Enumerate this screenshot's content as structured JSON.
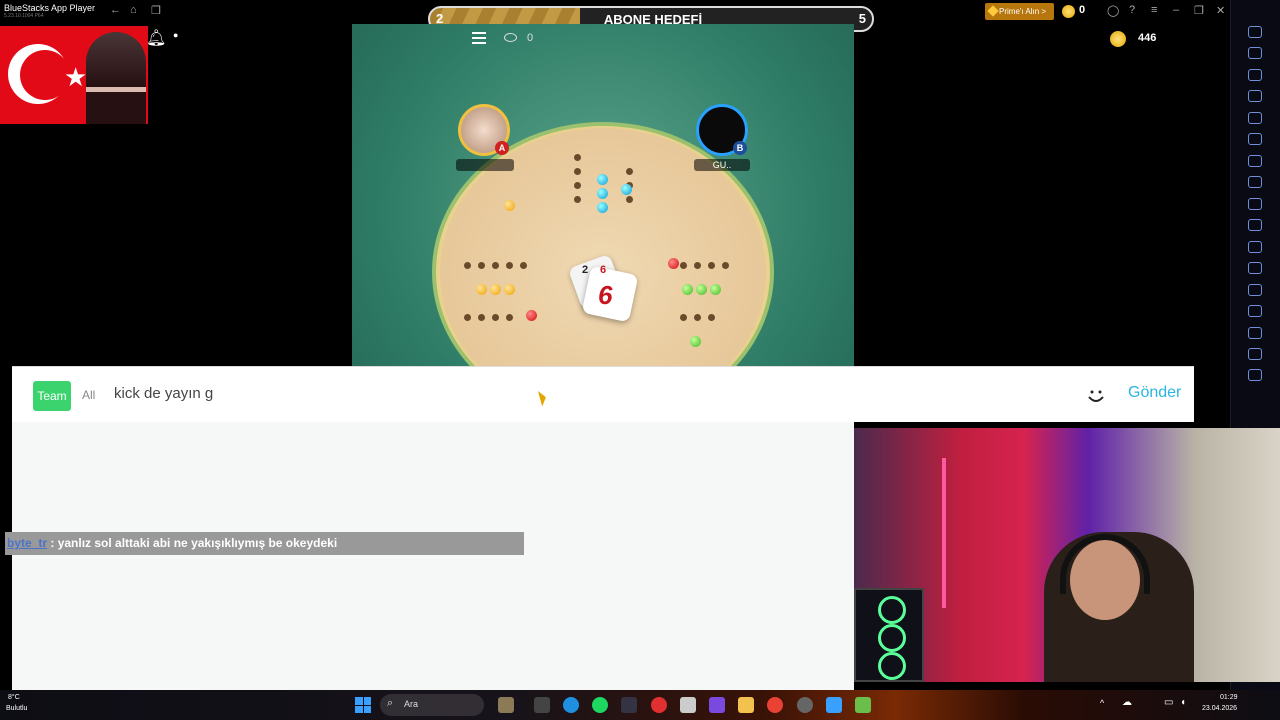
{
  "app": {
    "title": "BlueStacks App Player",
    "version": "5.23.10.1004 P64"
  },
  "goal_banner": {
    "left_number": "2",
    "title": "ABONE HEDEFİ",
    "right_number": "5"
  },
  "topbar": {
    "premium_label": "Prime'ı Alın >",
    "coins": "0"
  },
  "game": {
    "coins": "446",
    "viewers": "0",
    "player_a": {
      "badge": "A",
      "name": ""
    },
    "player_b": {
      "badge": "B",
      "name": "GU.."
    },
    "dice": {
      "main": "6",
      "small_a": "2",
      "small_b": "6"
    }
  },
  "chat": {
    "tab_team": "Team",
    "tab_all": "All",
    "input_value": "kick de yayın g",
    "send_label": "Gönder",
    "message": {
      "user": "byte_tr",
      "separator": " : ",
      "text": "yanlız sol alttaki abi ne yakışıklıymış be okeydeki"
    }
  },
  "taskbar": {
    "weather_temp": "8°C",
    "weather_desc": "Bulutlu",
    "search_label": "Ara",
    "clock_time": "01:29",
    "clock_date": "23.04.2026"
  },
  "colors": {
    "team_tab": "#3ad36e",
    "send": "#2bb5e0",
    "flag_red": "#e30a17"
  }
}
